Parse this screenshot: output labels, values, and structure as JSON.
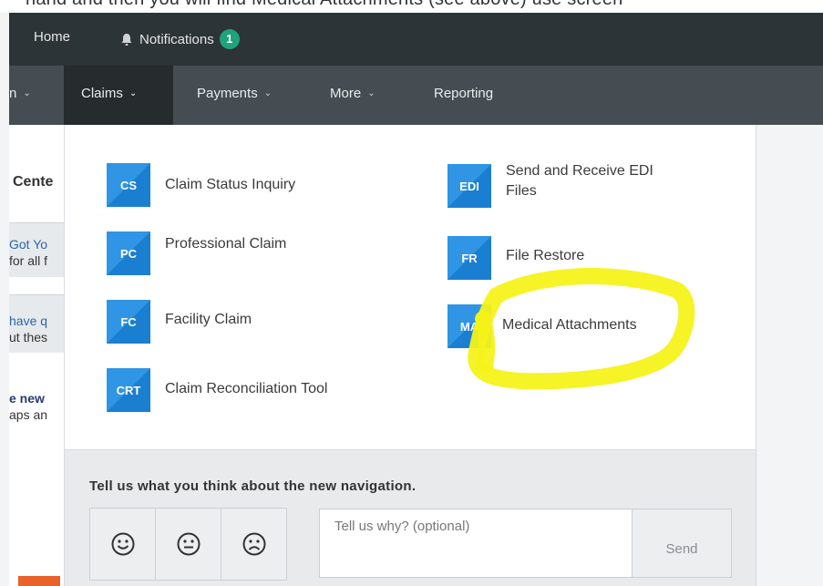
{
  "top_strip_text": "hand and then you will find Medical Attachments (see above) use screen",
  "topbar": {
    "home_label": "Home",
    "notifications_label": "Notifications",
    "notifications_count": "1"
  },
  "nav": {
    "first_partial": "n",
    "claims": "Claims",
    "payments": "Payments",
    "more": "More",
    "reporting": "Reporting"
  },
  "left_pane": {
    "heading": "Cente",
    "row1_line1": "Got Yo",
    "row1_line2": "for all f",
    "row2_line1": "have q",
    "row2_line2": "ut thes",
    "row3_line1": "e new",
    "row3_line2": "aps an"
  },
  "menu": {
    "left": [
      {
        "abbr": "CS",
        "label": "Claim Status Inquiry"
      },
      {
        "abbr": "PC",
        "label": "Professional Claim"
      },
      {
        "abbr": "FC",
        "label": "Facility Claim"
      },
      {
        "abbr": "CRT",
        "label": "Claim Reconciliation Tool"
      }
    ],
    "right": [
      {
        "abbr": "EDI",
        "label_line1": "Send and Receive EDI",
        "label_line2": "Files"
      },
      {
        "abbr": "FR",
        "label": "File Restore"
      },
      {
        "abbr": "MA",
        "label": "Medical Attachments"
      }
    ]
  },
  "feedback": {
    "title": "Tell us what you think about the new navigation.",
    "placeholder": "Tell us why? (optional)",
    "send": "Send"
  },
  "colors": {
    "tile_blue": "#1a7fd0",
    "tile_blue_light": "#2f95e4",
    "highlight_yellow": "#f5f21a",
    "badge_green": "#1fa37a"
  }
}
